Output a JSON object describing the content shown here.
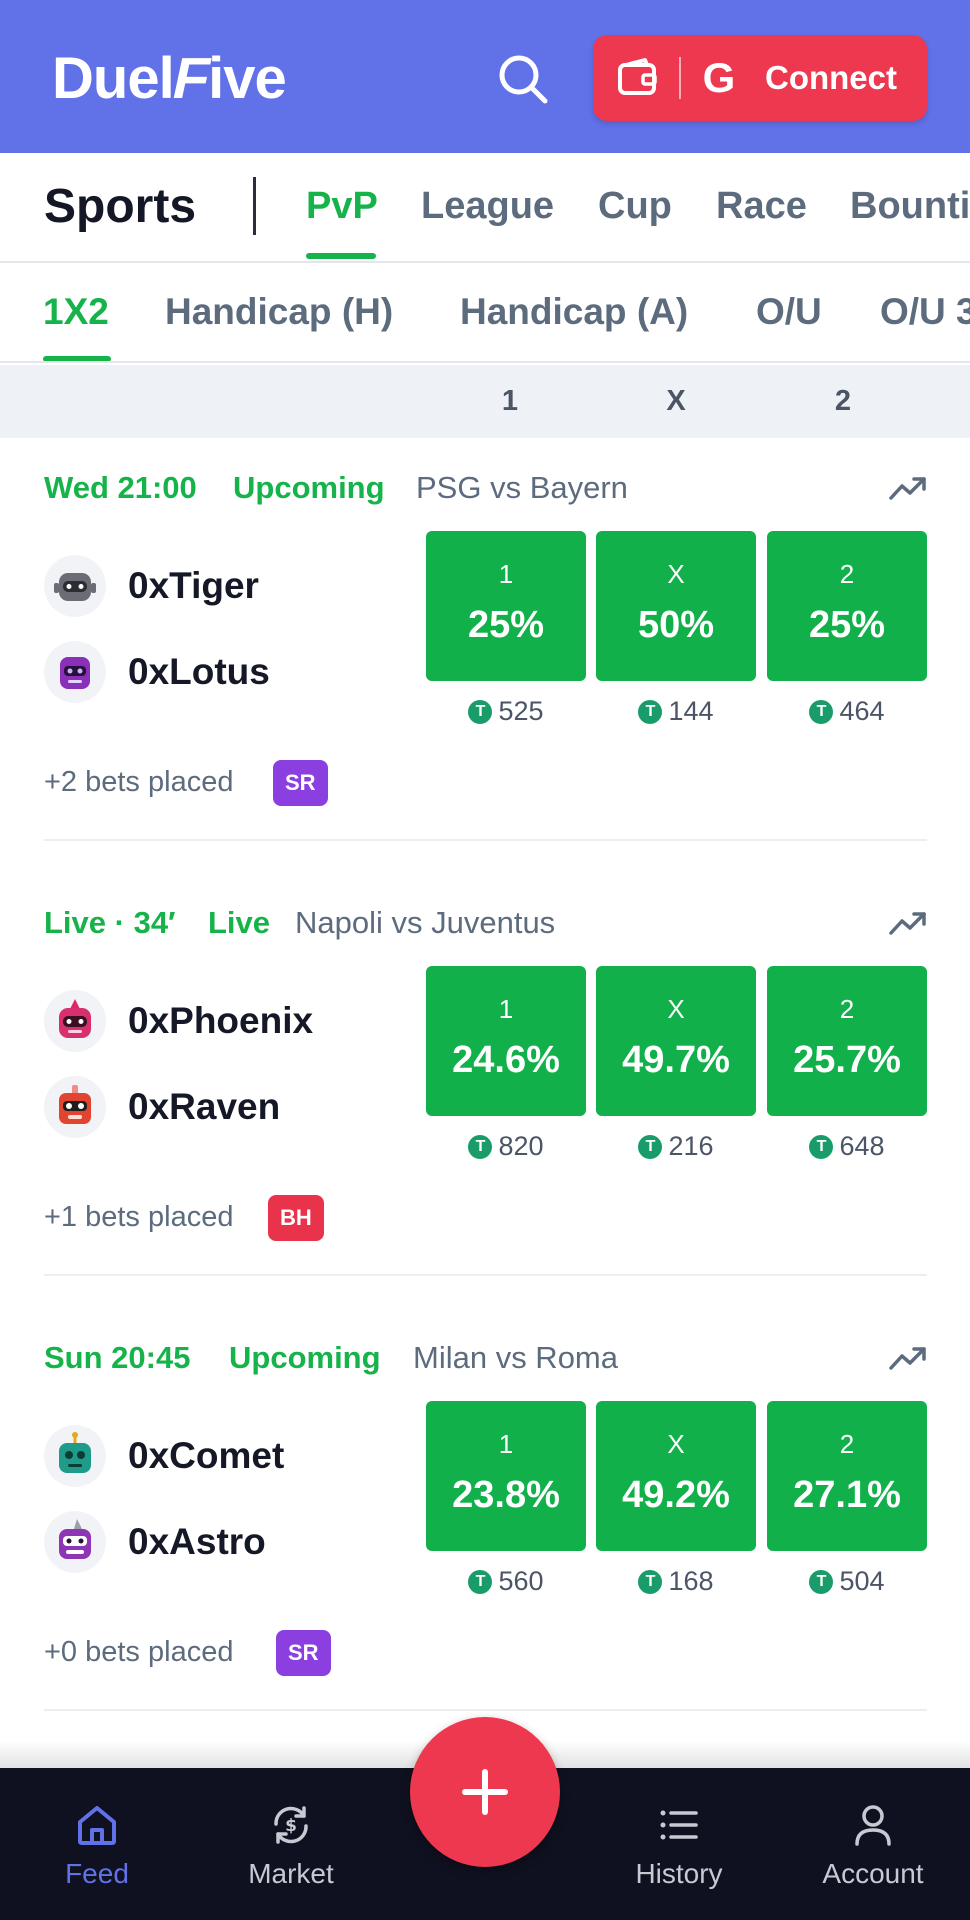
{
  "header": {
    "logo_part1": "Duel",
    "logo_part2": "F",
    "logo_part3": "ive",
    "connect_label": "Connect",
    "google_glyph": "G"
  },
  "categories": {
    "title": "Sports",
    "tabs": [
      "PvP",
      "League",
      "Cup",
      "Race",
      "Bounti"
    ],
    "active": "PvP"
  },
  "markets": {
    "tabs": [
      "1X2",
      "Handicap (H)",
      "Handicap (A)",
      "O/U",
      "O/U 3"
    ],
    "active": "1X2"
  },
  "columns": [
    "1",
    "X",
    "2"
  ],
  "matches": [
    {
      "status": "Wed 21:00",
      "state": "Upcoming",
      "teams": "PSG vs Bayern",
      "players": [
        "0xTiger",
        "0xLotus"
      ],
      "odds": [
        {
          "label": "1",
          "pct": "25%",
          "stake": "525"
        },
        {
          "label": "X",
          "pct": "50%",
          "stake": "144"
        },
        {
          "label": "2",
          "pct": "25%",
          "stake": "464"
        }
      ],
      "bets": "+2 bets placed",
      "badge": "SR",
      "badge_color": "#8b3fe0"
    },
    {
      "status": "Live · 34′",
      "state": "Live",
      "teams": "Napoli vs Juventus",
      "players": [
        "0xPhoenix",
        "0xRaven"
      ],
      "odds": [
        {
          "label": "1",
          "pct": "24.6%",
          "stake": "820"
        },
        {
          "label": "X",
          "pct": "49.7%",
          "stake": "216"
        },
        {
          "label": "2",
          "pct": "25.7%",
          "stake": "648"
        }
      ],
      "bets": "+1 bets placed",
      "badge": "BH",
      "badge_color": "#e8334a"
    },
    {
      "status": "Sun 20:45",
      "state": "Upcoming",
      "teams": "Milan vs Roma",
      "players": [
        "0xComet",
        "0xAstro"
      ],
      "odds": [
        {
          "label": "1",
          "pct": "23.8%",
          "stake": "560"
        },
        {
          "label": "X",
          "pct": "49.2%",
          "stake": "168"
        },
        {
          "label": "2",
          "pct": "27.1%",
          "stake": "504"
        }
      ],
      "bets": "+0 bets placed",
      "badge": "SR",
      "badge_color": "#8b3fe0"
    }
  ],
  "coin_glyph": "T",
  "nav": {
    "items": [
      "Feed",
      "Market",
      "History",
      "Account"
    ],
    "active": "Feed"
  },
  "colors": {
    "header": "#6171e8",
    "accent_red": "#ee3850",
    "green": "#12b04a",
    "nav_bg": "#0f1120"
  }
}
